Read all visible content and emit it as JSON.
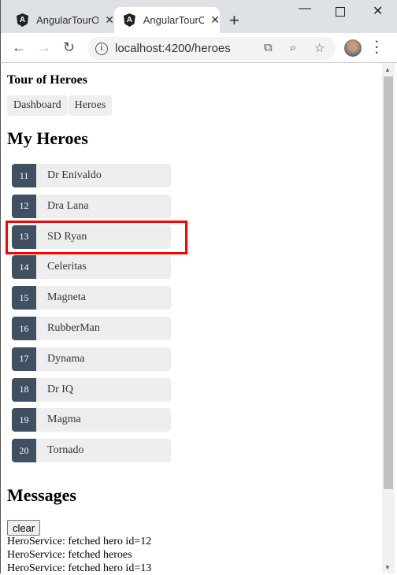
{
  "browser": {
    "tabs": [
      {
        "title": "AngularTourOfHeroes",
        "active": false
      },
      {
        "title": "AngularTourOfHeroes",
        "active": true
      }
    ],
    "url": "localhost:4200/heroes"
  },
  "app": {
    "title": "Tour of Heroes",
    "nav": [
      "Dashboard",
      "Heroes"
    ],
    "heading": "My Heroes",
    "heroes": [
      {
        "id": "11",
        "name": "Dr Enivaldo"
      },
      {
        "id": "12",
        "name": "Dra Lana"
      },
      {
        "id": "13",
        "name": "SD Ryan"
      },
      {
        "id": "14",
        "name": "Celeritas"
      },
      {
        "id": "15",
        "name": "Magneta"
      },
      {
        "id": "16",
        "name": "RubberMan"
      },
      {
        "id": "17",
        "name": "Dynama"
      },
      {
        "id": "18",
        "name": "Dr IQ"
      },
      {
        "id": "19",
        "name": "Magma"
      },
      {
        "id": "20",
        "name": "Tornado"
      }
    ],
    "highlighted_hero": "13"
  },
  "messages": {
    "heading": "Messages",
    "clear_label": "clear",
    "items": [
      "HeroService: fetched hero id=12",
      "HeroService: fetched heroes",
      "HeroService: fetched hero id=13"
    ]
  }
}
